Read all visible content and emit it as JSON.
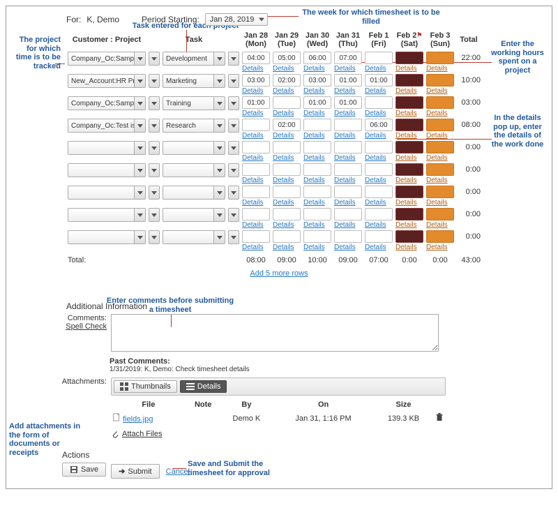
{
  "header": {
    "for_label": "For:",
    "for_value": "K, Demo",
    "period_label": "Period Starting:",
    "period_value": "Jan 28, 2019"
  },
  "annotations": {
    "week": "The week for which timesheet is to be filled",
    "task_entered": "Task entered for each project",
    "project_tracked": "The project for which time is to be tracked",
    "enter_hours": "Enter the working hours spent on a project",
    "details_popup": "In the details pop up, enter the details of the work done",
    "comments_before": "Enter comments before submitting a timesheet",
    "attachments_note": "Add attachments in the form of documents or receipts",
    "save_submit": "Save and Submit the timesheet for approval"
  },
  "columns": {
    "project": "Customer : Project",
    "task": "Task",
    "days": [
      {
        "top": "Jan 28",
        "bot": "(Mon)"
      },
      {
        "top": "Jan 29",
        "bot": "(Tue)"
      },
      {
        "top": "Jan 30",
        "bot": "(Wed)"
      },
      {
        "top": "Jan 31",
        "bot": "(Thu)"
      },
      {
        "top": "Feb 1",
        "bot": "(Fri)"
      },
      {
        "top": "Feb 2",
        "bot": "(Sat)"
      },
      {
        "top": "Feb 3",
        "bot": "(Sun)"
      }
    ],
    "total": "Total",
    "details": "Details"
  },
  "rows": [
    {
      "project": "Company_Oc:Sample...",
      "task": "Development",
      "hours": [
        "04:00",
        "05:00",
        "06:00",
        "07:00",
        "",
        "",
        ""
      ],
      "total": "22:00"
    },
    {
      "project": "New_Account:HR Pr...",
      "task": "Marketing",
      "hours": [
        "03:00",
        "02:00",
        "03:00",
        "01:00",
        "01:00",
        "",
        ""
      ],
      "total": "10:00"
    },
    {
      "project": "Company_Oc:Sample...",
      "task": "Training",
      "hours": [
        "01:00",
        "",
        "01:00",
        "01:00",
        "",
        "",
        ""
      ],
      "total": "03:00"
    },
    {
      "project": "Company_Oc:Test iss...",
      "task": "Research",
      "hours": [
        "",
        "02:00",
        "",
        "",
        "06:00",
        "",
        ""
      ],
      "total": "08:00"
    },
    {
      "project": "",
      "task": "",
      "hours": [
        "",
        "",
        "",
        "",
        "",
        "",
        ""
      ],
      "total": "0:00"
    },
    {
      "project": "",
      "task": "",
      "hours": [
        "",
        "",
        "",
        "",
        "",
        "",
        ""
      ],
      "total": "0:00"
    },
    {
      "project": "",
      "task": "",
      "hours": [
        "",
        "",
        "",
        "",
        "",
        "",
        ""
      ],
      "total": "0:00"
    },
    {
      "project": "",
      "task": "",
      "hours": [
        "",
        "",
        "",
        "",
        "",
        "",
        ""
      ],
      "total": "0:00"
    },
    {
      "project": "",
      "task": "",
      "hours": [
        "",
        "",
        "",
        "",
        "",
        "",
        ""
      ],
      "total": "0:00"
    }
  ],
  "totals": {
    "label": "Total:",
    "days": [
      "08:00",
      "09:00",
      "10:00",
      "09:00",
      "07:00",
      "0:00",
      "0:00"
    ],
    "grand": "43:00"
  },
  "add_rows": "Add 5 more rows",
  "additional_info": "Additional Information",
  "comments_label": "Comments:",
  "spell_check": "Spell Check",
  "past_comments": {
    "label": "Past Comments:",
    "entry": "1/31/2019: K, Demo: Check timesheet details"
  },
  "attachments": {
    "label": "Attachments:",
    "thumbnails": "Thumbnails",
    "details": "Details",
    "headers": {
      "file": "File",
      "note": "Note",
      "by": "By",
      "on": "On",
      "size": "Size"
    },
    "row": {
      "file": "fields.jpg",
      "note": "",
      "by": "Demo K",
      "on": "Jan 31, 1:16 PM",
      "size": "139.3 KB"
    },
    "attach_files": "Attach Files"
  },
  "actions": {
    "label": "Actions",
    "save": "Save",
    "submit": "Submit",
    "cancel": "Cancel"
  }
}
